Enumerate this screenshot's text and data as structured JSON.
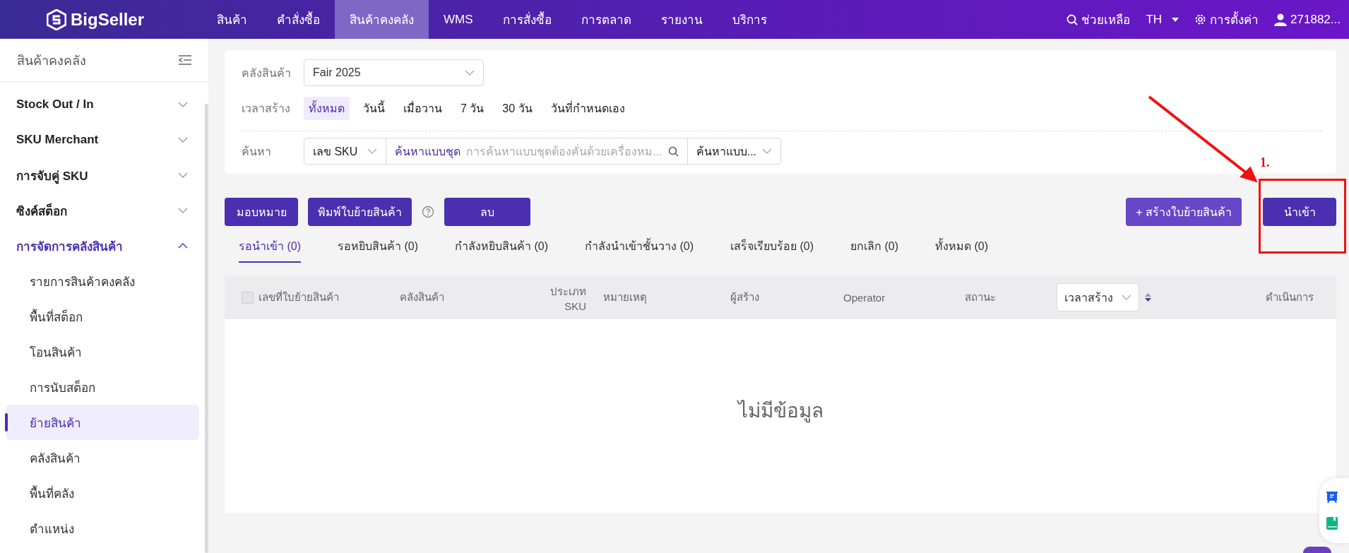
{
  "header": {
    "logo": "BigSeller",
    "nav": [
      {
        "label": "สินค้า",
        "selected": false
      },
      {
        "label": "คำสั่งซื้อ",
        "selected": false
      },
      {
        "label": "สินค้าคงคลัง",
        "selected": true
      },
      {
        "label": "WMS",
        "selected": false
      },
      {
        "label": "การสั่งซื้อ",
        "selected": false
      },
      {
        "label": "การตลาด",
        "selected": false
      },
      {
        "label": "รายงาน",
        "selected": false
      },
      {
        "label": "บริการ",
        "selected": false
      }
    ],
    "help": "ช่วยเหลือ",
    "language": "TH",
    "settings": "การตั้งค่า",
    "user": "271882..."
  },
  "sidebar": {
    "title": "สินค้าคงคลัง",
    "groups": [
      {
        "label": "Stock Out / In",
        "expanded": false
      },
      {
        "label": "SKU Merchant",
        "expanded": false
      },
      {
        "label": "การจับคู่ SKU",
        "expanded": false
      },
      {
        "label": "ซิงค์สต็อก",
        "expanded": false
      },
      {
        "label": "การจัดการคลังสินค้า",
        "expanded": true,
        "children": [
          {
            "label": "รายการสินค้าคงคลัง",
            "selected": false
          },
          {
            "label": "พื้นที่สต็อก",
            "selected": false
          },
          {
            "label": "โอนสินค้า",
            "selected": false
          },
          {
            "label": "การนับสต็อก",
            "selected": false
          },
          {
            "label": "ย้ายสินค้า",
            "selected": true
          },
          {
            "label": "คลังสินค้า",
            "selected": false
          },
          {
            "label": "พื้นที่คลัง",
            "selected": false
          },
          {
            "label": "ตำแหน่ง",
            "selected": false
          }
        ]
      }
    ]
  },
  "filters": {
    "warehouse": {
      "label": "คลังสินค้า",
      "value": "Fair 2025"
    },
    "created_time": {
      "label": "เวลาสร้าง",
      "options": [
        {
          "label": "ทั้งหมด",
          "selected": true
        },
        {
          "label": "วันนี้",
          "selected": false
        },
        {
          "label": "เมื่อวาน",
          "selected": false
        },
        {
          "label": "7 วัน",
          "selected": false
        },
        {
          "label": "30 วัน",
          "selected": false
        },
        {
          "label": "วันที่กำหนดเอง",
          "selected": false
        }
      ]
    },
    "search": {
      "label": "ค้นหา",
      "field": "เลข SKU",
      "mode": "ค้นหาแบบชุด",
      "placeholder": "การค้นหาแบบชุดต้องคั่นด้วยเครื่องหม...",
      "option": "ค้นหาแบบ..."
    }
  },
  "actions": {
    "left": [
      "มอบหมาย",
      "พิมพ์ใบย้ายสินค้า",
      "ลบ"
    ],
    "create": "+ สร้างใบย้ายสินค้า",
    "import": "นำเข้า"
  },
  "tabs": [
    {
      "label": "รอนำเข้า (0)",
      "selected": true
    },
    {
      "label": "รอหยิบสินค้า (0)",
      "selected": false
    },
    {
      "label": "กำลังหยิบสินค้า (0)",
      "selected": false
    },
    {
      "label": "กำลังนำเข้าชั้นวาง (0)",
      "selected": false
    },
    {
      "label": "เสร็จเรียบร้อย (0)",
      "selected": false
    },
    {
      "label": "ยกเลิก (0)",
      "selected": false
    },
    {
      "label": "ทั้งหมด (0)",
      "selected": false
    }
  ],
  "table": {
    "select_all_checked": false,
    "columns": [
      {
        "kind": "text",
        "label": "เลขที่ใบย้ายสินค้า"
      },
      {
        "kind": "text",
        "label": "คลังสินค้า"
      },
      {
        "kind": "right",
        "label": "ประเภท SKU"
      },
      {
        "kind": "text",
        "label": "หมายเหตุ"
      },
      {
        "kind": "text",
        "label": "ผู้สร้าง"
      },
      {
        "kind": "text",
        "label": "Operator"
      },
      {
        "kind": "text",
        "label": "สถานะ"
      },
      {
        "kind": "sort_select",
        "label": "เวลาสร้าง"
      },
      {
        "kind": "text",
        "label": "ดำเนินการ"
      }
    ],
    "empty_text": "ไม่มีข้อมูล"
  },
  "annotation": {
    "step": "1."
  }
}
